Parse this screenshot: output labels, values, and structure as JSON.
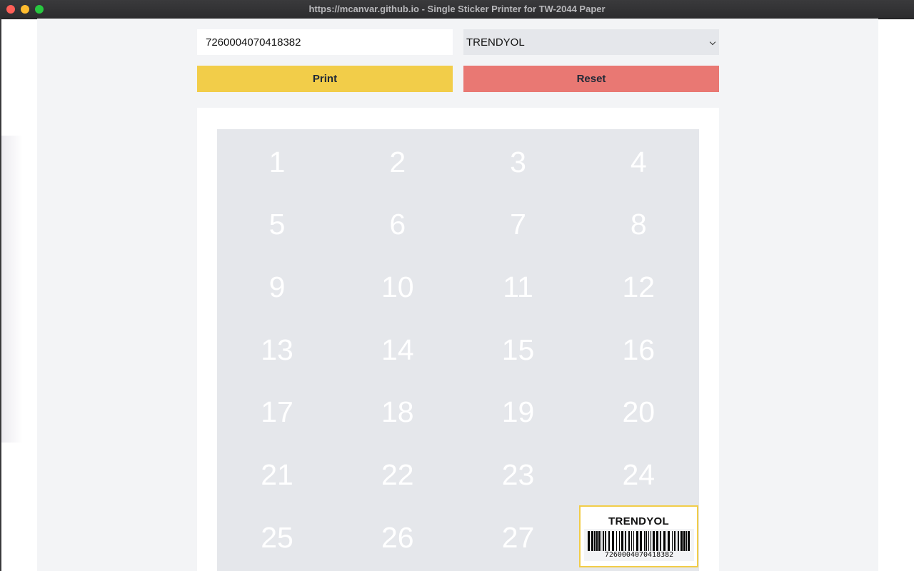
{
  "window": {
    "title": "https://mcanvar.github.io - Single Sticker Printer for TW-2044 Paper"
  },
  "form": {
    "barcode_value": "7260004070418382",
    "brand_selected": "TRENDYOL"
  },
  "buttons": {
    "print_label": "Print",
    "reset_label": "Reset"
  },
  "sheet": {
    "visible_cells": [
      "1",
      "2",
      "3",
      "4",
      "5",
      "6",
      "7",
      "8",
      "9",
      "10",
      "11",
      "12",
      "13",
      "14",
      "15",
      "16",
      "17",
      "18",
      "19",
      "20",
      "21",
      "22",
      "23",
      "24",
      "25",
      "26",
      "27"
    ],
    "selected_cell": "28"
  },
  "sticker": {
    "brand": "TRENDYOL",
    "barcode_number": "7260004070418382"
  },
  "colors": {
    "print_button": "#f2cd49",
    "reset_button": "#e97873",
    "sheet": "#e5e7eb",
    "sticker_border": "#f2cd49"
  },
  "icons": {
    "select_arrow": "chevron-down-icon",
    "window_controls": [
      "close-icon",
      "minimize-icon",
      "maximize-icon"
    ]
  }
}
